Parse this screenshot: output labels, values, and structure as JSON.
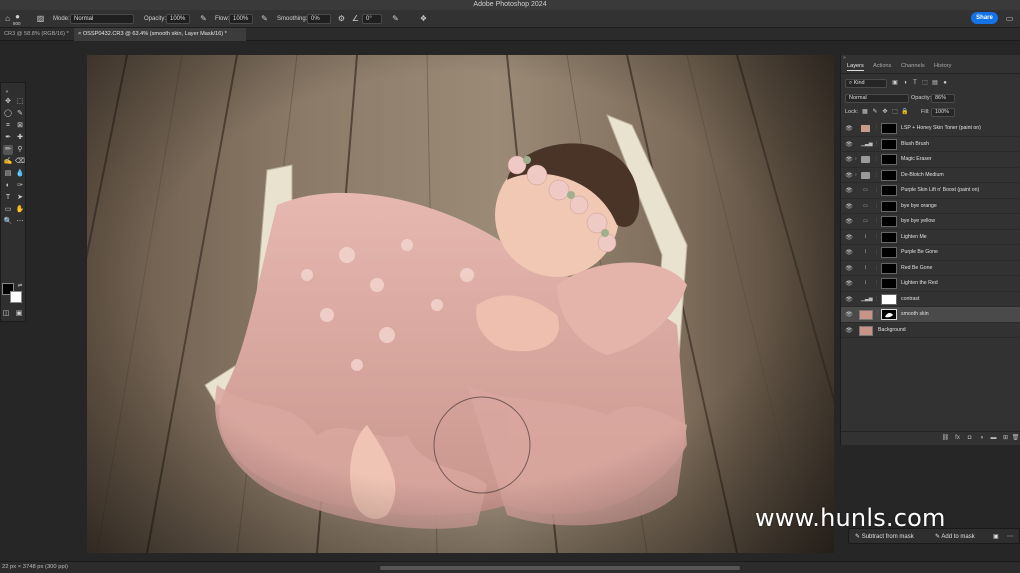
{
  "app": {
    "title": "Adobe Photoshop 2024"
  },
  "options": {
    "brush_size": "800",
    "mode_label": "Mode:",
    "mode_value": "Normal",
    "opacity_label": "Opacity:",
    "opacity_value": "100%",
    "flow_label": "Flow:",
    "flow_value": "100%",
    "smoothing_label": "Smoothing:",
    "smoothing_value": "0%",
    "angle_value": "0°",
    "share_label": "Share"
  },
  "tabs": [
    {
      "label": "CR3 @ 58.8% (RGB/16) *"
    },
    {
      "label": "OSSP0432.CR3 @ 63.4% (smooth skin, Layer Mask/16) *"
    }
  ],
  "panel": {
    "tabs": [
      "Layers",
      "Actions",
      "Channels",
      "History"
    ],
    "filter_value": "Kind",
    "blend_mode": "Normal",
    "opacity_label": "Opacity:",
    "opacity_value": "86%",
    "lock_label": "Lock:",
    "fill_label": "Fill:",
    "fill_value": "100%"
  },
  "layers": [
    {
      "name": "LSP + Honey Skin Toner (paint on)",
      "kind": "pixel",
      "thumb": "black"
    },
    {
      "name": "Blush Brush",
      "kind": "levels",
      "thumb": "black"
    },
    {
      "name": "Magic Eraser",
      "kind": "group",
      "thumb": "black"
    },
    {
      "name": "De-Blotch Medium",
      "kind": "group",
      "thumb": "black"
    },
    {
      "name": "Purple Skin Lift n' Boost (paint on)",
      "kind": "adjust",
      "thumb": "black"
    },
    {
      "name": "bye bye orange",
      "kind": "adjust",
      "thumb": "black"
    },
    {
      "name": "bye bye yellow",
      "kind": "adjust",
      "thumb": "black"
    },
    {
      "name": "Lighten Me",
      "kind": "curves",
      "thumb": "black"
    },
    {
      "name": "Purple Be Gone",
      "kind": "curves",
      "thumb": "black"
    },
    {
      "name": "Red Be Gone",
      "kind": "curves",
      "thumb": "black"
    },
    {
      "name": "Lighten the Red",
      "kind": "curves",
      "thumb": "black"
    },
    {
      "name": "contrast",
      "kind": "levels",
      "thumb": "white"
    },
    {
      "name": "smooth skin",
      "kind": "photo",
      "thumb": "mask",
      "selected": true
    },
    {
      "name": "Background",
      "kind": "photo-only",
      "thumb": "none"
    }
  ],
  "mask_bar": {
    "subtract_label": "Subtract from mask",
    "add_label": "Add to mask"
  },
  "status": {
    "text": "22 px × 3748 px (300 ppi)"
  },
  "watermark": {
    "text": "www.hunls.com"
  }
}
